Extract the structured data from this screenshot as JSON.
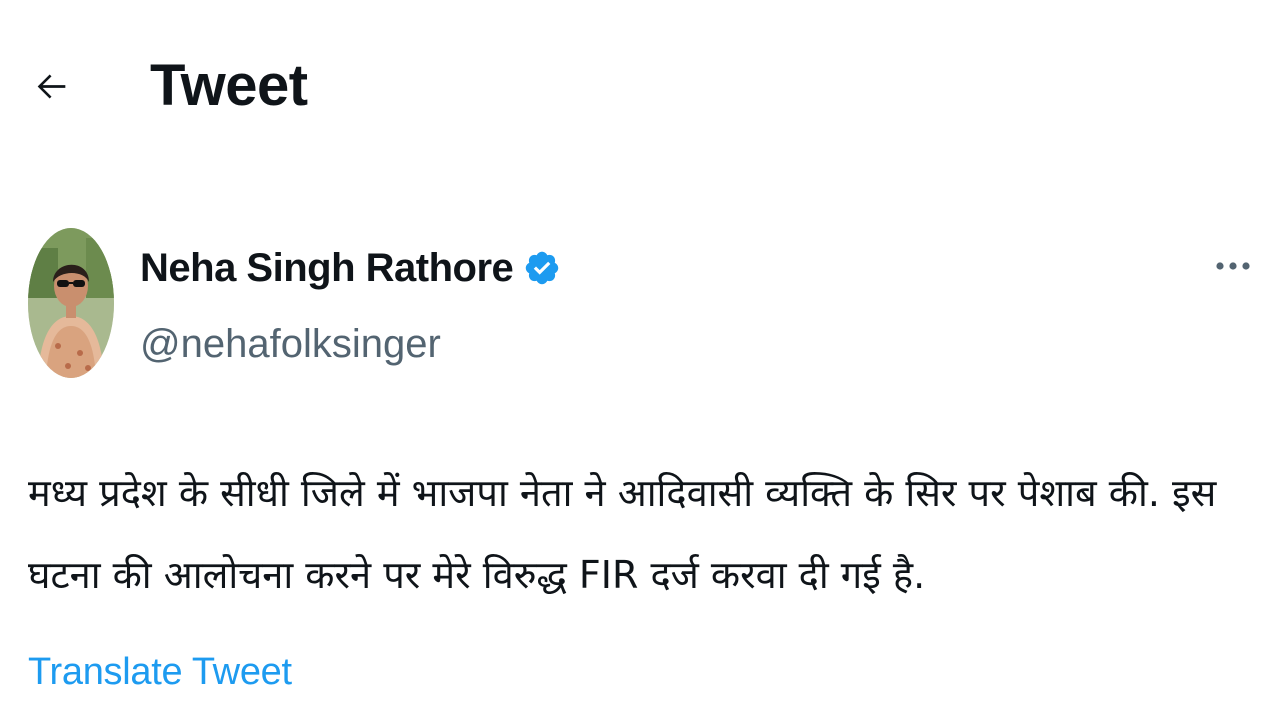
{
  "header": {
    "back_icon": "arrow-left-icon",
    "title": "Tweet"
  },
  "author": {
    "name": "Neha Singh Rathore",
    "handle": "@nehafolksinger",
    "verified_icon": "verified-badge-icon",
    "verified_color": "#1d9bf0"
  },
  "more_icon": "more-horizontal-icon",
  "tweet": {
    "text": "मध्य प्रदेश के सीधी जिले में भाजपा नेता ने आदिवासी व्यक्ति के सिर पर पेशाब की. इस\nघटना की आलोचना करने पर मेरे विरुद्ध FIR दर्ज करवा दी गई है.",
    "translate_label": "Translate Tweet"
  },
  "colors": {
    "text": "#0f1419",
    "secondary": "#536471",
    "accent": "#1d9bf0"
  }
}
